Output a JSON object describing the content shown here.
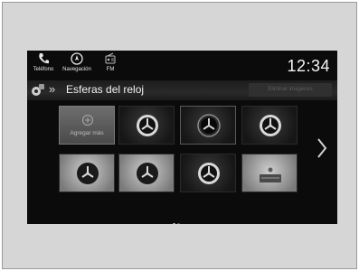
{
  "status_bar": {
    "items": [
      {
        "label": "Teléfono",
        "icon": "phone-icon"
      },
      {
        "label": "Navegación",
        "icon": "compass-icon"
      },
      {
        "label": "FM",
        "icon": "radio-icon"
      }
    ],
    "clock": "12:34"
  },
  "title_bar": {
    "title": "Esferas del reloj",
    "delete_label": "Eliminar imágenes",
    "icon": "settings-icon",
    "breadcrumb_icon": "double-chevron-icon"
  },
  "grid": {
    "add_label": "Agregar más",
    "tiles": [
      {
        "kind": "add"
      },
      {
        "kind": "clock-dark"
      },
      {
        "kind": "clock-dark"
      },
      {
        "kind": "clock-dark"
      },
      {
        "kind": "clock-light"
      },
      {
        "kind": "clock-light"
      },
      {
        "kind": "clock-dark"
      },
      {
        "kind": "image-light"
      }
    ]
  },
  "pager": {
    "pages": 2,
    "current": 1
  },
  "colors": {
    "screen": "#0b0b0b",
    "text": "#f2f2f2",
    "frame": "#d6d6d6"
  }
}
